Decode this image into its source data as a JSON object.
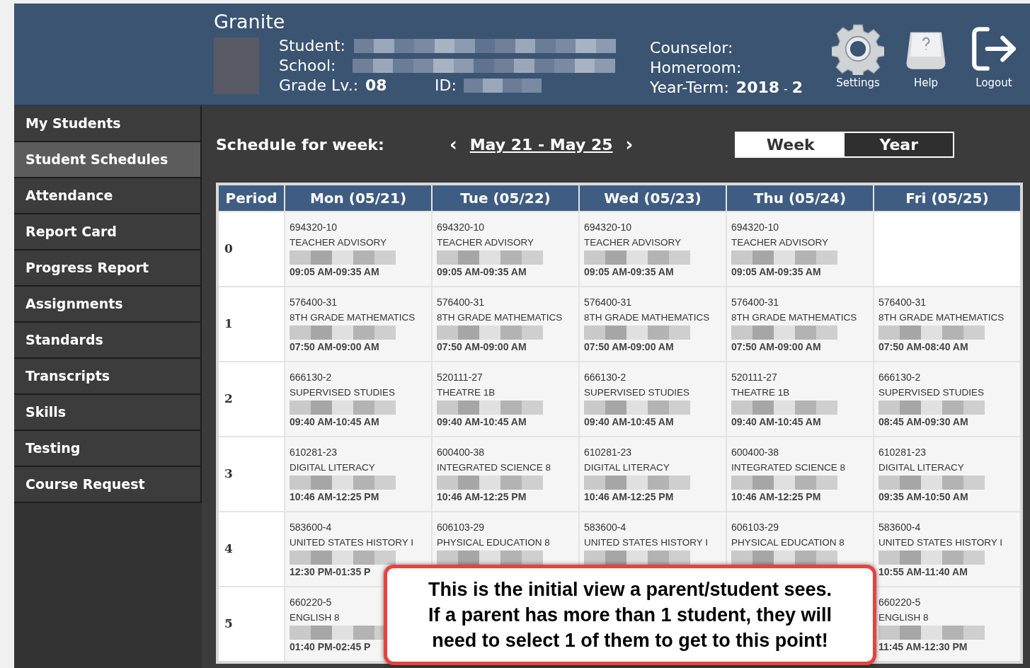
{
  "header": {
    "app_title": "Granite",
    "student": {
      "label": "Student:",
      "redacted": true
    },
    "school": {
      "label": "School:",
      "redacted": true
    },
    "grade": {
      "label": "Grade Lv.:",
      "value": "08"
    },
    "id": {
      "label": "ID:",
      "redacted": true
    },
    "counselor": {
      "label": "Counselor:"
    },
    "homeroom": {
      "label": "Homeroom:"
    },
    "year_term": {
      "label": "Year-Term:",
      "year": "2018",
      "separator": "-",
      "term": "2"
    },
    "actions": [
      {
        "kind": "settings",
        "label": "Settings"
      },
      {
        "kind": "help",
        "label": "Help"
      },
      {
        "kind": "logout",
        "label": "Logout"
      }
    ]
  },
  "sidebar": {
    "items": [
      {
        "label": "My Students",
        "selected": false
      },
      {
        "label": "Student Schedules",
        "selected": true
      },
      {
        "label": "Attendance",
        "selected": false
      },
      {
        "label": "Report Card",
        "selected": false
      },
      {
        "label": "Progress Report",
        "selected": false
      },
      {
        "label": "Assignments",
        "selected": false
      },
      {
        "label": "Standards",
        "selected": false
      },
      {
        "label": "Transcripts",
        "selected": false
      },
      {
        "label": "Skills",
        "selected": false
      },
      {
        "label": "Testing",
        "selected": false
      },
      {
        "label": "Course Request",
        "selected": false
      }
    ]
  },
  "schedule": {
    "title": "Schedule for week:",
    "prev": "‹",
    "range": "May 21 - May 25",
    "next": "›",
    "views": [
      {
        "label": "Week",
        "selected": true
      },
      {
        "label": "Year",
        "selected": false
      }
    ]
  },
  "table": {
    "columns": [
      "Period",
      "Mon (05/21)",
      "Tue (05/22)",
      "Wed (05/23)",
      "Thu (05/24)",
      "Fri (05/25)"
    ],
    "rows": [
      {
        "cells": [
          {
            "kind": "period",
            "text": "0"
          },
          {
            "kind": "class",
            "code": "694320-10",
            "title": "TEACHER ADVISORY",
            "redacted": true,
            "time": "09:05 AM-09:35 AM"
          },
          {
            "kind": "class",
            "code": "694320-10",
            "title": "TEACHER ADVISORY",
            "redacted": true,
            "time": "09:05 AM-09:35 AM"
          },
          {
            "kind": "class",
            "code": "694320-10",
            "title": "TEACHER ADVISORY",
            "redacted": true,
            "time": "09:05 AM-09:35 AM"
          },
          {
            "kind": "class",
            "code": "694320-10",
            "title": "TEACHER ADVISORY",
            "redacted": true,
            "time": "09:05 AM-09:35 AM"
          },
          {
            "kind": "empty"
          }
        ]
      },
      {
        "cells": [
          {
            "kind": "period",
            "text": "1"
          },
          {
            "kind": "class",
            "code": "576400-31",
            "title": "8TH GRADE MATHEMATICS",
            "redacted": true,
            "time": "07:50 AM-09:00 AM"
          },
          {
            "kind": "class",
            "code": "576400-31",
            "title": "8TH GRADE MATHEMATICS",
            "redacted": true,
            "time": "07:50 AM-09:00 AM"
          },
          {
            "kind": "class",
            "code": "576400-31",
            "title": "8TH GRADE MATHEMATICS",
            "redacted": true,
            "time": "07:50 AM-09:00 AM"
          },
          {
            "kind": "class",
            "code": "576400-31",
            "title": "8TH GRADE MATHEMATICS",
            "redacted": true,
            "time": "07:50 AM-09:00 AM"
          },
          {
            "kind": "class",
            "code": "576400-31",
            "title": "8TH GRADE MATHEMATICS",
            "redacted": true,
            "time": "07:50 AM-08:40 AM"
          }
        ]
      },
      {
        "cells": [
          {
            "kind": "period",
            "text": "2"
          },
          {
            "kind": "class",
            "code": "666130-2",
            "title": "SUPERVISED STUDIES",
            "redacted": true,
            "time": "09:40 AM-10:45 AM"
          },
          {
            "kind": "class",
            "code": "520111-27",
            "title": "THEATRE 1B",
            "redacted": true,
            "time": "09:40 AM-10:45 AM"
          },
          {
            "kind": "class",
            "code": "666130-2",
            "title": "SUPERVISED STUDIES",
            "redacted": true,
            "time": "09:40 AM-10:45 AM"
          },
          {
            "kind": "class",
            "code": "520111-27",
            "title": "THEATRE 1B",
            "redacted": true,
            "time": "09:40 AM-10:45 AM"
          },
          {
            "kind": "class",
            "code": "666130-2",
            "title": "SUPERVISED STUDIES",
            "redacted": true,
            "time": "08:45 AM-09:30 AM"
          }
        ]
      },
      {
        "cells": [
          {
            "kind": "period",
            "text": "3"
          },
          {
            "kind": "class",
            "code": "610281-23",
            "title": "DIGITAL LITERACY",
            "redacted": true,
            "time": "10:46 AM-12:25 PM"
          },
          {
            "kind": "class",
            "code": "600400-38",
            "title": "INTEGRATED SCIENCE 8",
            "redacted": true,
            "time": "10:46 AM-12:25 PM"
          },
          {
            "kind": "class",
            "code": "610281-23",
            "title": "DIGITAL LITERACY",
            "redacted": true,
            "time": "10:46 AM-12:25 PM"
          },
          {
            "kind": "class",
            "code": "600400-38",
            "title": "INTEGRATED SCIENCE 8",
            "redacted": true,
            "time": "10:46 AM-12:25 PM"
          },
          {
            "kind": "class",
            "code": "610281-23",
            "title": "DIGITAL LITERACY",
            "redacted": true,
            "time": "09:35 AM-10:50 AM"
          }
        ]
      },
      {
        "cells": [
          {
            "kind": "period",
            "text": "4"
          },
          {
            "kind": "class",
            "code": "583600-4",
            "title": "UNITED STATES HISTORY I",
            "redacted": true,
            "time": "12:30 PM-01:35 P"
          },
          {
            "kind": "class",
            "code": "606103-29",
            "title": "PHYSICAL EDUCATION 8",
            "redacted": true
          },
          {
            "kind": "class",
            "code": "583600-4",
            "title": "UNITED STATES HISTORY I",
            "redacted": true
          },
          {
            "kind": "class",
            "code": "606103-29",
            "title": "PHYSICAL EDUCATION 8",
            "redacted": true
          },
          {
            "kind": "class",
            "code": "583600-4",
            "title": "UNITED STATES HISTORY I",
            "redacted": true,
            "time": "10:55 AM-11:40 AM"
          }
        ]
      },
      {
        "cells": [
          {
            "kind": "period",
            "text": "5"
          },
          {
            "kind": "class",
            "code": "660220-5",
            "title": "ENGLISH 8",
            "redacted": true,
            "time": "01:40 PM-02:45 P"
          },
          {
            "kind": "covered"
          },
          {
            "kind": "covered"
          },
          {
            "kind": "covered"
          },
          {
            "kind": "class",
            "code": "660220-5",
            "title": "ENGLISH 8",
            "redacted": true,
            "time": "11:45 AM-12:30 PM"
          }
        ]
      }
    ]
  },
  "callout": {
    "lines": [
      "This is the initial view a parent/student sees.",
      "If a parent has more than 1 student, they will",
      "need to select 1 of them to get to this point!"
    ]
  }
}
